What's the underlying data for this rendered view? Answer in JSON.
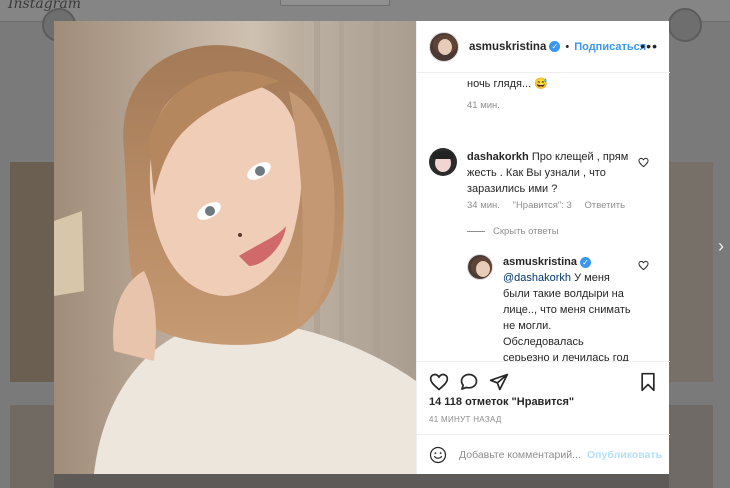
{
  "background": {
    "logo": "Instagram"
  },
  "post": {
    "author": "asmuskristina",
    "follow_label": "Подписаться",
    "more_label": "•••",
    "likes_text": "14 118 отметок \"Нравится\"",
    "time_text": "41 МИНУТ НАЗАД",
    "comment_placeholder": "Добавьте комментарий...",
    "publish_label": "Опубликовать"
  },
  "comments": [
    {
      "text_fragment": "ночь глядя... 😅",
      "time": "41 мин."
    },
    {
      "author": "dashakorkh",
      "text": "Про клещей , прям жесть . Как Вы узнали , что заразились ими ?",
      "time": "34 мин.",
      "likes": "\"Нравится\": 3",
      "reply_label": "Ответить"
    }
  ],
  "hide_replies_label": "Скрыть ответы",
  "reply": {
    "author": "asmuskristina",
    "mention": "@dashakorkh",
    "text": " У меня были такие волдыри на лице.., что меня снимать не могли. Обследовалась серьезно и лечилась год всем, чем только можно... Пока не"
  },
  "colors": {
    "accent": "#3897f0",
    "publish_disabled": "#b2dffc",
    "meta_text": "#8e8e8e"
  }
}
